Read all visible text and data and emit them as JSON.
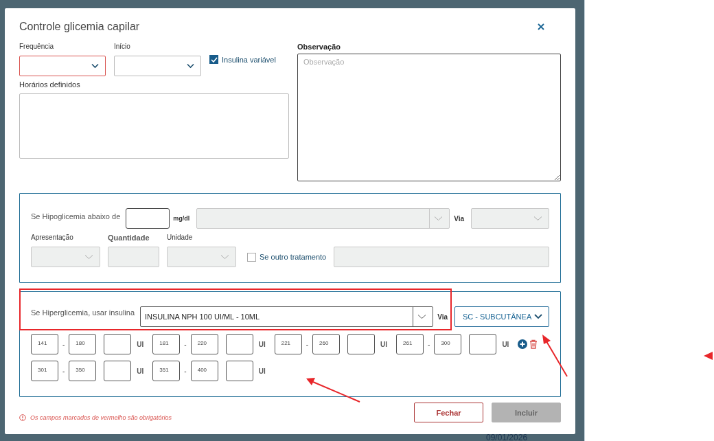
{
  "window": {
    "title": "Controle glicemia capilar"
  },
  "frequencia": {
    "label": "Frequência",
    "required": true
  },
  "inicio": {
    "label": "Início",
    "required": false
  },
  "insulina_variavel": {
    "label": "Insulina variável",
    "checked": true
  },
  "horarios": {
    "label": "Horários definidos"
  },
  "observacao": {
    "label": "Observação",
    "placeholder": "Observação"
  },
  "hypo": {
    "label": "Se Hipoglicemia abaixo de",
    "unit": "mg/dl",
    "via_label": "Via",
    "presentation_label": "Apresentação",
    "quantity_label": "Quantidade",
    "unit_label": "Unidade",
    "disabled": true,
    "other_treatment": {
      "label": "Se outro tratamento",
      "checked": false
    }
  },
  "hyper": {
    "label": "Se Hiperglicemia, usar insulina",
    "insulin": "INSULINA NPH 100 UI/ML  - 10ML",
    "via_label": "Via",
    "via": "SC - SUBCUTÂNEA",
    "rows": [
      {
        "actions": true,
        "ranges": [
          {
            "from": "141",
            "sep": "-",
            "to": "180",
            "unit": "UI"
          },
          {
            "from": "181",
            "sep": "-",
            "to": "220",
            "unit": "UI"
          },
          {
            "from": "221",
            "sep": "-",
            "to": "260",
            "unit": "UI"
          },
          {
            "from": "261",
            "sep": "-",
            "to": "300",
            "unit": "UI"
          }
        ]
      },
      {
        "actions": false,
        "ranges": [
          {
            "from": "301",
            "sep": "-",
            "to": "350",
            "unit": "UI"
          },
          {
            "from": "351",
            "sep": "-",
            "to": "400",
            "unit": "UI"
          }
        ]
      }
    ]
  },
  "footer": {
    "message": "Os campos marcados de vermelho são obrigatórios",
    "buttons": [
      {
        "label": "Fechar",
        "kind": "secondary",
        "disabled": false
      },
      {
        "label": "Incluir",
        "kind": "primary",
        "disabled": true
      }
    ]
  },
  "background_date": "09/01/2026"
}
